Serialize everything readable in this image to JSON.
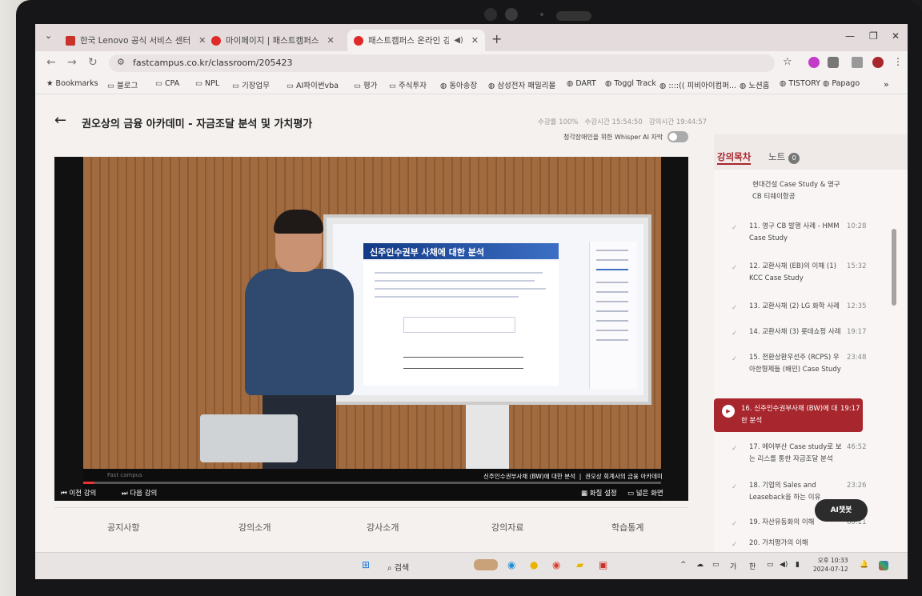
{
  "browser": {
    "tabs": [
      {
        "label": "한국 Lenovo 공식 서비스 센터"
      },
      {
        "label": "마이페이지 | 패스트캠퍼스"
      },
      {
        "label": "패스트캠퍼스 온라인 강의"
      }
    ],
    "url": "fastcampus.co.kr/classroom/205423",
    "bookmarks": [
      "Bookmarks",
      "블로그",
      "CPA",
      "NPL",
      "기장업무",
      "AI파이썬vba",
      "평가",
      "주식투자",
      "동아송장",
      "삼성전자 패밀리몰",
      "DART",
      "Toggl Track",
      "::::(( 피비아이컴퍼...",
      "노션홈",
      "TISTORY",
      "Papago"
    ]
  },
  "course": {
    "title": "권오상의 금융 아카데미 - 자금조달 분석 및 가치평가",
    "stats": {
      "progress": "수강률 100%",
      "watch_time": "수강시간 15:54:50",
      "lecture_time": "강의시간 19:44:57"
    },
    "whisper_label": "청각장애인을 위한 Whisper AI 자막"
  },
  "video": {
    "slide_title": "신주인수권부 사채에 대한 분석",
    "caption_left": "신주인수권부사채 (BW)에 대한 분석",
    "caption_right": "권오상 회계사의 금융 아카데미",
    "watermark": "Fast campus",
    "progress": 0.02,
    "prev_label": "이전 강의",
    "next_label": "다음 강의",
    "quality_label": "화질 설정",
    "wide_label": "넓은 화면"
  },
  "bottom_tabs": [
    "공지사항",
    "강의소개",
    "강사소개",
    "강의자료",
    "학습통계"
  ],
  "panel": {
    "tab_toc": "강의목차",
    "tab_notes": "노트",
    "notes_count": "0",
    "items": [
      {
        "title": "현대건설 Case Study & 영구CB 티웨이항공",
        "duration": ""
      },
      {
        "title": "11. 영구 CB 발행 사례 - HMM Case Study",
        "duration": "10:28"
      },
      {
        "title": "12. 교환사채 (EB)의 이해 (1) KCC Case Study",
        "duration": "15:32"
      },
      {
        "title": "13. 교환사채 (2) LG 화학 사례",
        "duration": "12:35"
      },
      {
        "title": "14. 교환사채 (3) 롯데쇼핑 사례",
        "duration": "19:17"
      },
      {
        "title": "15. 전환상환우선주 (RCPS) 우아한형제들 (배민) Case Study",
        "duration": "23:48"
      },
      {
        "title": "16. 신주인수권부사채 (BW)에 대한 분석",
        "duration": "19:17"
      },
      {
        "title": "17. 에어부산 Case study로 보는 리스를 통한 자금조달 분석",
        "duration": "46:52"
      },
      {
        "title": "18. 기업의 Sales and Leaseback을 하는 이유",
        "duration": "23:26"
      },
      {
        "title": "19. 자산유동화의 이해",
        "duration": "60:11"
      },
      {
        "title": "20. 가치평가의 이해",
        "duration": ""
      }
    ]
  },
  "aichat_label": "AI챗봇",
  "taskbar": {
    "search": "검색",
    "tray": [
      "가",
      "한"
    ],
    "time": "오후 10:33",
    "date": "2024-07-12"
  }
}
